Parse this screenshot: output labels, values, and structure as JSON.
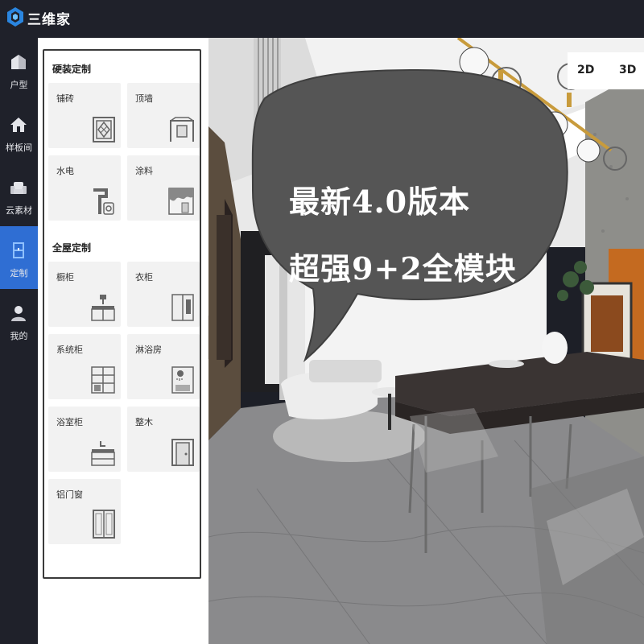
{
  "app": {
    "brand": "三维家"
  },
  "nav": {
    "items": [
      {
        "label": "户型",
        "icon": "house-icon"
      },
      {
        "label": "样板间",
        "icon": "model-home-icon"
      },
      {
        "label": "云素材",
        "icon": "sofa-icon"
      },
      {
        "label": "定制",
        "icon": "cabinet-icon",
        "active": true
      },
      {
        "label": "我的",
        "icon": "user-icon"
      }
    ]
  },
  "panel": {
    "sections": [
      {
        "title": "硬装定制",
        "tiles": [
          {
            "label": "铺砖",
            "icon": "tile-icon"
          },
          {
            "label": "顶墙",
            "icon": "ceiling-icon"
          },
          {
            "label": "水电",
            "icon": "plumbing-icon"
          },
          {
            "label": "涂料",
            "icon": "paint-icon"
          }
        ]
      },
      {
        "title": "全屋定制",
        "tiles": [
          {
            "label": "橱柜",
            "icon": "kitchen-cabinet-icon"
          },
          {
            "label": "衣柜",
            "icon": "wardrobe-icon"
          },
          {
            "label": "系统柜",
            "icon": "system-cabinet-icon"
          },
          {
            "label": "淋浴房",
            "icon": "shower-room-icon"
          },
          {
            "label": "浴室柜",
            "icon": "bathroom-cabinet-icon"
          },
          {
            "label": "整木",
            "icon": "wood-door-icon"
          },
          {
            "label": "铝门窗",
            "icon": "aluminum-window-icon"
          }
        ]
      }
    ]
  },
  "view": {
    "mode_2d": "2D",
    "mode_3d": "3D"
  },
  "overlay": {
    "line1": "最新4.0版本",
    "line2": "超强9+2全模块"
  },
  "colors": {
    "accent": "#2f6ed3",
    "sidebar": "#1f212a",
    "bubble": "#555555"
  }
}
